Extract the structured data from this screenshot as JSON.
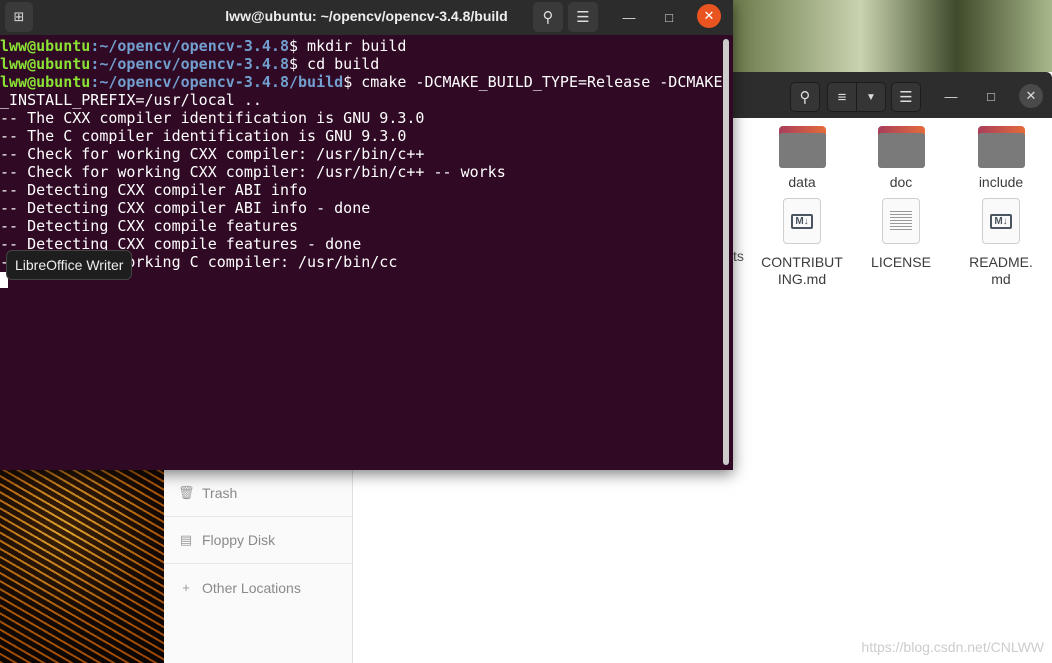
{
  "terminal": {
    "title": "lww@ubuntu: ~/opencv/opencv-3.4.8/build",
    "new_tab_icon": "new-tab-icon",
    "lines": [
      {
        "user": "lww@ubuntu",
        "path": ":~/opencv/opencv-3.4.8",
        "cmd": "$ mkdir build"
      },
      {
        "user": "lww@ubuntu",
        "path": ":~/opencv/opencv-3.4.8",
        "cmd": "$ cd build"
      },
      {
        "user": "lww@ubuntu",
        "path": ":~/opencv/opencv-3.4.8/build",
        "cmd": "$ cmake -DCMAKE_BUILD_TYPE=Release -DCMAKE"
      }
    ],
    "output": [
      "_INSTALL_PREFIX=/usr/local ..",
      "-- The CXX compiler identification is GNU 9.3.0",
      "-- The C compiler identification is GNU 9.3.0",
      "-- Check for working CXX compiler: /usr/bin/c++",
      "-- Check for working CXX compiler: /usr/bin/c++ -- works",
      "-- Detecting CXX compiler ABI info",
      "-- Detecting CXX compiler ABI info - done",
      "-- Detecting CXX compile features",
      "-- Detecting CXX compile features - done",
      "-- Check for working C compiler: /usr/bin/cc"
    ]
  },
  "tooltip": "LibreOffice Writer",
  "files": {
    "partial_label": "ts",
    "items": [
      {
        "name": "data",
        "type": "folder"
      },
      {
        "name": "doc",
        "type": "folder"
      },
      {
        "name": "include",
        "type": "folder"
      },
      {
        "name": "CONTRIBUT ING.md",
        "type": "markdown"
      },
      {
        "name": "LICENSE",
        "type": "text"
      },
      {
        "name": "README. md",
        "type": "markdown"
      }
    ]
  },
  "sidebar": {
    "items": [
      {
        "label": "Trash",
        "icon": "trash-icon"
      },
      {
        "label": "Floppy Disk",
        "icon": "floppy-icon"
      },
      {
        "label": "Other Locations",
        "icon": "plus-icon"
      }
    ]
  },
  "watermark": "https://blog.csdn.net/CNLWW"
}
